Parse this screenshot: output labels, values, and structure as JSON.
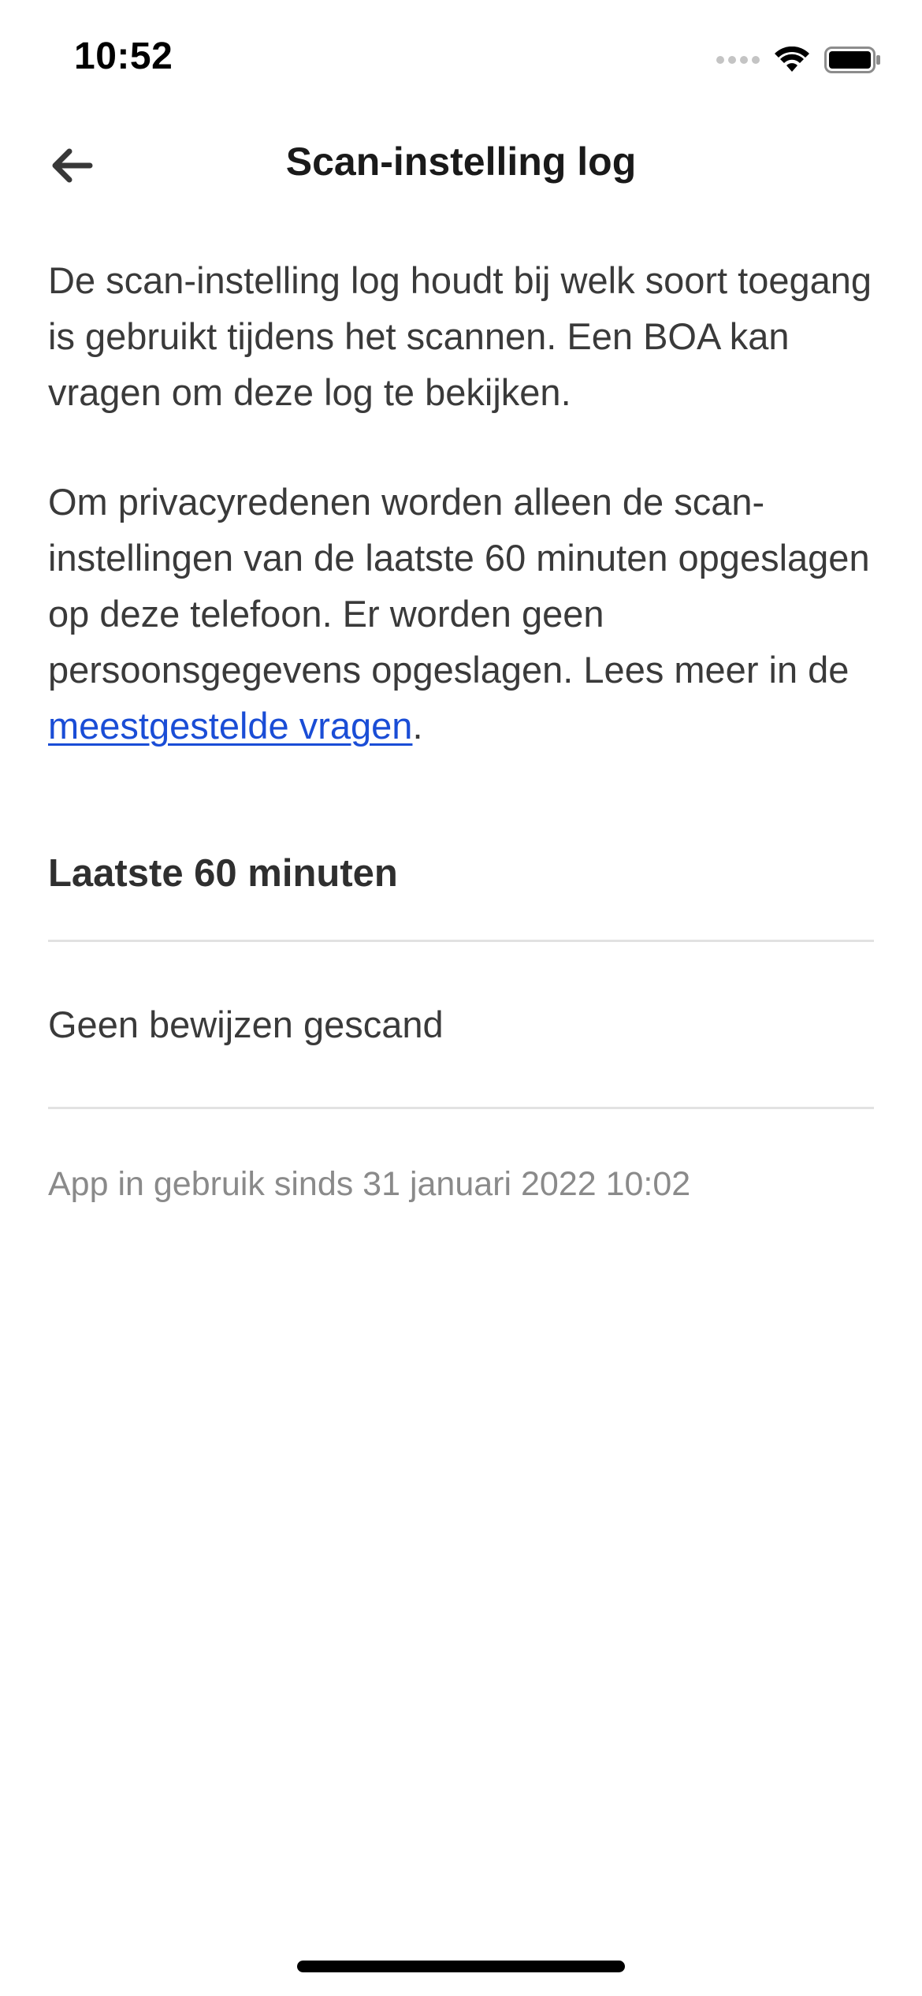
{
  "status_bar": {
    "time": "10:52",
    "icons": [
      "cellular-signal-icon",
      "wifi-icon",
      "battery-icon"
    ]
  },
  "nav": {
    "back_icon": "arrow-left-icon",
    "title": "Scan-instelling log"
  },
  "intro": {
    "paragraph_1": "De scan-instelling log houdt bij welk soort toegang is gebruikt tijdens het scannen. Een BOA kan vragen om deze log te bekijken.",
    "paragraph_2_text": "Om privacyredenen worden alleen de scan-instellingen van de laatste 60 minuten opgeslagen op deze telefoon. Er worden geen persoonsgegevens opgeslagen. Lees meer in de ",
    "faq_link_label": "meestgestelde vragen",
    "paragraph_2_end": "."
  },
  "log": {
    "heading": "Laatste 60 minuten",
    "empty_message": "Geen bewijzen gescand",
    "app_since": "App in gebruik sinds 31 januari 2022 10:02"
  },
  "colors": {
    "link": "#1a4dd6",
    "text": "#3a3a3a",
    "muted": "#8a8a8a",
    "divider": "#e2e2e2"
  }
}
